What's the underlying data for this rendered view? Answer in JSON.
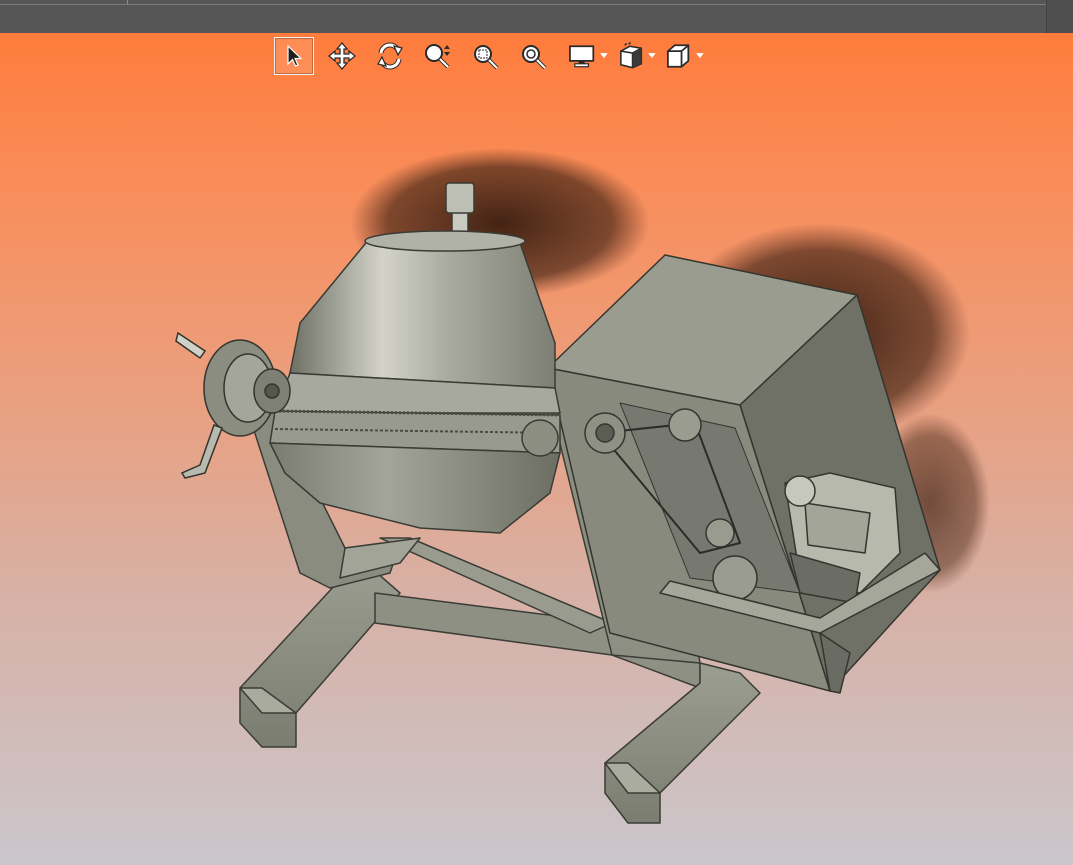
{
  "app": {
    "title_bar_color": "#565656",
    "viewport_gradient": [
      "#ff7c3c",
      "#cbc6cb"
    ]
  },
  "toolbar": {
    "tools": [
      {
        "id": "select",
        "icon": "arrow-cursor-icon",
        "active": true
      },
      {
        "id": "pan",
        "icon": "move-arrows-icon",
        "active": false
      },
      {
        "id": "rotate",
        "icon": "rotate-icon",
        "active": false
      },
      {
        "id": "zoom",
        "icon": "zoom-updown-icon",
        "active": false
      },
      {
        "id": "zoom-window",
        "icon": "zoom-window-icon",
        "active": false
      },
      {
        "id": "zoom-fit",
        "icon": "zoom-fit-icon",
        "active": false
      },
      {
        "id": "display-mode",
        "icon": "monitor-icon",
        "dropdown": true
      },
      {
        "id": "view-orientation",
        "icon": "view-cube-icon",
        "dropdown": true
      },
      {
        "id": "projection",
        "icon": "box-outline-icon",
        "dropdown": true
      }
    ]
  },
  "model": {
    "description_icon": "concrete-mixer-3d-model",
    "colors": {
      "metal": "#7a7c70",
      "drum_light": "#c7c7bd",
      "frame": "#8d8f82",
      "shadow": "#3e2418"
    }
  }
}
